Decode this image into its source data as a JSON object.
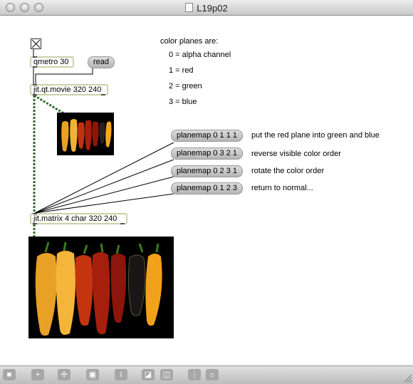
{
  "window": {
    "title": "L19p02"
  },
  "patch": {
    "metro": "qmetro 30",
    "read": "read",
    "movie": "jit.qt.movie 320 240",
    "matrix": "jit.matrix 4 char 320 240",
    "planes_header": "color planes are:",
    "planes": [
      "0 = alpha channel",
      "1 = red",
      "2 = green",
      "3 = blue"
    ],
    "planemaps": [
      {
        "msg": "planemap 0 1 1 1",
        "comment": "put the red plane into green and blue"
      },
      {
        "msg": "planemap 0 3 2 1",
        "comment": "reverse visible color order"
      },
      {
        "msg": "planemap 0 2 3 1",
        "comment": "rotate the color order"
      },
      {
        "msg": "planemap 0 1 2 3",
        "comment": "return to normal..."
      }
    ]
  },
  "colors": {
    "object_border": "#c9d2a7",
    "matrix_cord": "#2e6b2a",
    "message_fill": "#c8c8c8"
  },
  "toolbar_icons": [
    "lock-icon",
    "add-icon",
    "move-icon",
    "presentation-icon",
    "inspector-icon",
    "subpatch-icon",
    "window-icon",
    "grid-icon",
    "snap-icon"
  ]
}
